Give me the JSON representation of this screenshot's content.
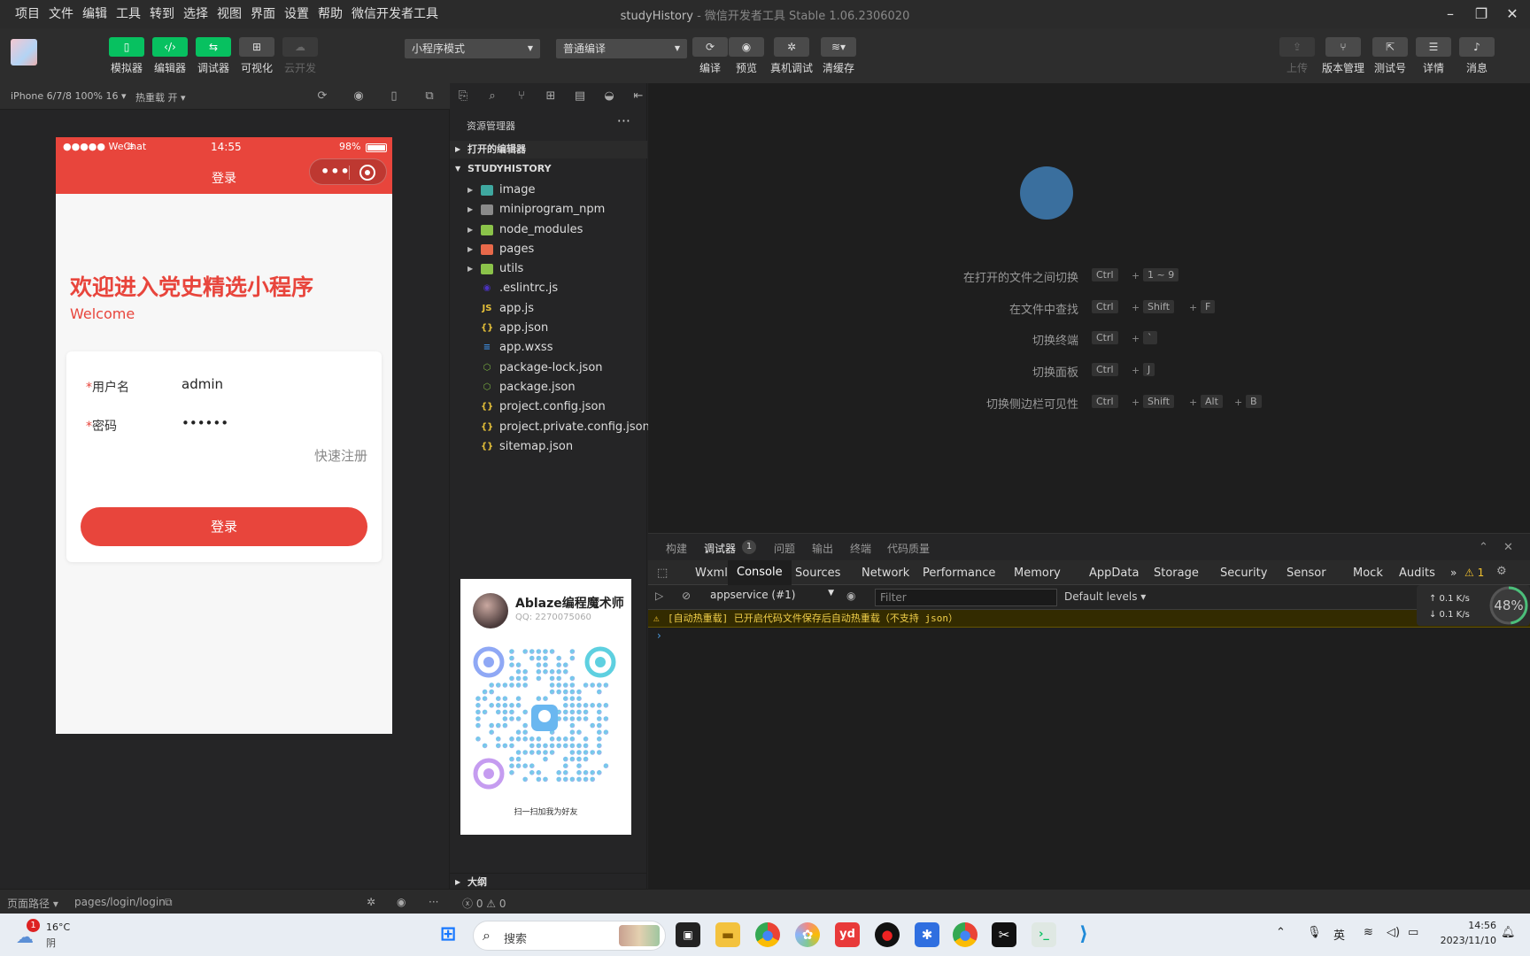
{
  "menu": [
    "项目",
    "文件",
    "编辑",
    "工具",
    "转到",
    "选择",
    "视图",
    "界面",
    "设置",
    "帮助",
    "微信开发者工具"
  ],
  "window": {
    "title": "studyHistory",
    "subtitle": " - 微信开发者工具 Stable 1.06.2306020"
  },
  "toolbar": {
    "simulator": "模拟器",
    "editor": "编辑器",
    "debugger": "调试器",
    "visual": "可视化",
    "cloud": "云开发",
    "mode": "小程序模式",
    "compile_mode": "普通编译",
    "compile": "编译",
    "preview": "预览",
    "remote_debug": "真机调试",
    "clear_cache": "清缓存",
    "upload": "上传",
    "version": "版本管理",
    "testid": "测试号",
    "details": "详情",
    "messages": "消息"
  },
  "sim": {
    "device": "iPhone 6/7/8 100% 16 ▾",
    "hotreload": "热重载 开 ▾",
    "carrier": "●●●●● WeChat",
    "time": "14:55",
    "battery": "98%",
    "page_title": "登录",
    "welcome_title": "欢迎进入党史精选小程序",
    "welcome_sub": "Welcome",
    "username_label": "用户名",
    "username_value": "admin",
    "password_label": "密码",
    "password_value": "••••••",
    "required_mark": "*",
    "quick_register": "快速注册",
    "login_button": "登录"
  },
  "explorer": {
    "title": "资源管理器",
    "open_editors": "打开的编辑器",
    "project": "STUDYHISTORY",
    "items": [
      {
        "name": "image",
        "folder": true,
        "color": "#3fa8a0",
        "glyph": ""
      },
      {
        "name": "miniprogram_npm",
        "folder": true,
        "color": "#8a8a8a",
        "glyph": ""
      },
      {
        "name": "node_modules",
        "folder": true,
        "color": "#8bc34a",
        "glyph": ""
      },
      {
        "name": "pages",
        "folder": true,
        "color": "#e8694a",
        "glyph": ""
      },
      {
        "name": "utils",
        "folder": true,
        "color": "#8bc34a",
        "glyph": ""
      },
      {
        "name": ".eslintrc.js",
        "folder": false,
        "color": "#4b32c3",
        "glyph": "◉"
      },
      {
        "name": "app.js",
        "folder": false,
        "color": "#e5c039",
        "glyph": "JS"
      },
      {
        "name": "app.json",
        "folder": false,
        "color": "#e5c039",
        "glyph": "{}"
      },
      {
        "name": "app.wxss",
        "folder": false,
        "color": "#3c88d8",
        "glyph": "≡"
      },
      {
        "name": "package-lock.json",
        "folder": false,
        "color": "#7cb342",
        "glyph": "⬡"
      },
      {
        "name": "package.json",
        "folder": false,
        "color": "#7cb342",
        "glyph": "⬡"
      },
      {
        "name": "project.config.json",
        "folder": false,
        "color": "#e5c039",
        "glyph": "{}"
      },
      {
        "name": "project.private.config.json",
        "folder": false,
        "color": "#e5c039",
        "glyph": "{}"
      },
      {
        "name": "sitemap.json",
        "folder": false,
        "color": "#e5c039",
        "glyph": "{}"
      }
    ],
    "outline": "大纲"
  },
  "qrcard": {
    "name": "Ablaze编程魔术师",
    "qq": "QQ: 2270075060",
    "caption": "扫一扫加我为好友"
  },
  "shortcuts": [
    {
      "label": "在打开的文件之间切换",
      "keys": [
        "Ctrl",
        "1 ~ 9"
      ]
    },
    {
      "label": "在文件中查找",
      "keys": [
        "Ctrl",
        "Shift",
        "F"
      ]
    },
    {
      "label": "切换终端",
      "keys": [
        "Ctrl",
        "`"
      ]
    },
    {
      "label": "切换面板",
      "keys": [
        "Ctrl",
        "J"
      ]
    },
    {
      "label": "切换侧边栏可见性",
      "keys": [
        "Ctrl",
        "Shift",
        "Alt",
        "B"
      ]
    }
  ],
  "panel_tabs": [
    "构建",
    "调试器",
    "问题",
    "输出",
    "终端",
    "代码质量"
  ],
  "debugger_badge": "1",
  "devtools_tabs": [
    "Wxml",
    "Console",
    "Sources",
    "Network",
    "Performance",
    "Memory",
    "AppData",
    "Storage",
    "Security",
    "Sensor",
    "Mock",
    "Audits"
  ],
  "devtools": {
    "more": "»",
    "warn_count": "⚠ 1",
    "context": "appservice (#1)",
    "filter_placeholder": "Filter",
    "levels": "Default levels ▾",
    "warning": "[自动热重载] 已开启代码文件保存后自动热重载（不支持 json）",
    "prompt": "›",
    "net_up": "0.1",
    "net_down": "0.1",
    "net_unit": "K/s",
    "cpu": "48",
    "cpu_unit": "%"
  },
  "statusbar": {
    "path_label": "页面路径 ▾",
    "path": "pages/login/login",
    "errors": "ⓧ 0 ⚠ 0"
  },
  "taskbar": {
    "temp": "16°C",
    "weather": "阴",
    "weather_badge": "1",
    "search": "搜索",
    "ime": "英",
    "time": "14:56",
    "date": "2023/11/10"
  },
  "colors": {
    "accent": "#07c160",
    "brand_red": "#e8453c"
  }
}
